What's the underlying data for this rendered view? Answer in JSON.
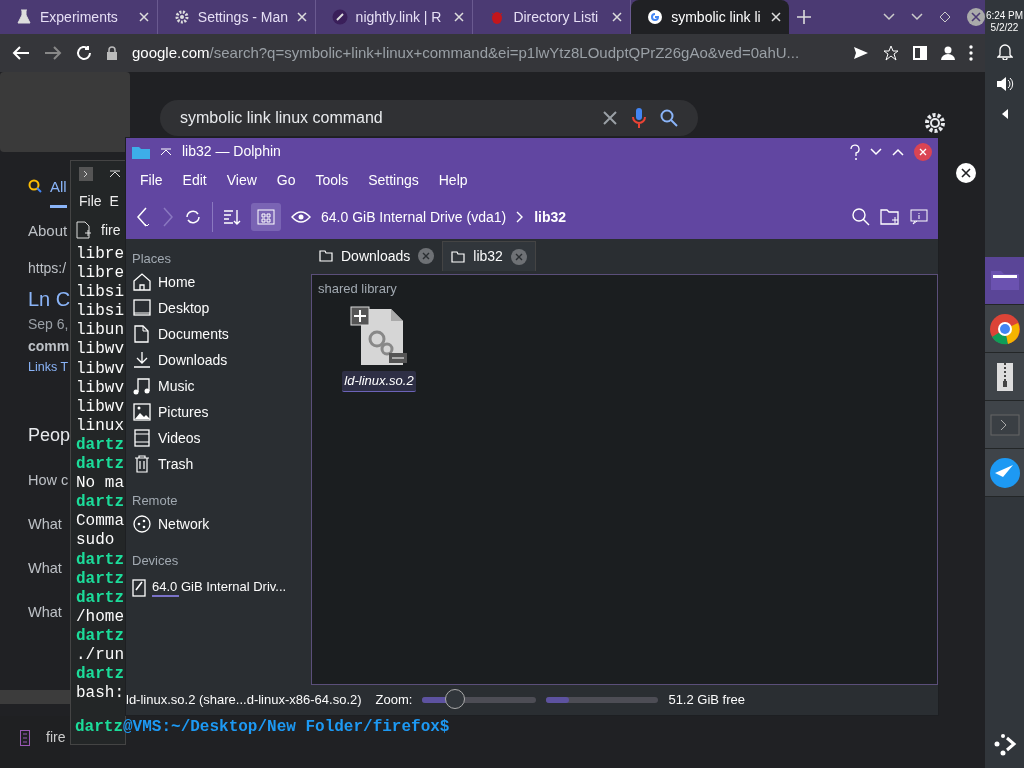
{
  "browser": {
    "tabs": [
      {
        "label": "Experiments",
        "selected": false
      },
      {
        "label": "Settings - Man",
        "selected": false
      },
      {
        "label": "nightly.link | R",
        "selected": false
      },
      {
        "label": "Directory Listi",
        "selected": false
      },
      {
        "label": "symbolic link li",
        "selected": true
      }
    ],
    "address": {
      "host": "google.com",
      "rest": "/search?q=symbolic+link+linux+command&ei=p1lwYtz8LOudptQPrZ26gAo&ved=0ahU..."
    }
  },
  "google": {
    "query": "symbolic link linux command",
    "items": [
      {
        "kind": "tab",
        "text": "All"
      },
      {
        "kind": "meta",
        "text": "About"
      },
      {
        "kind": "url",
        "text": "https:/"
      },
      {
        "kind": "title",
        "text": "Ln C"
      },
      {
        "kind": "date",
        "text": "Sep 6,"
      },
      {
        "kind": "bold",
        "text": "comm"
      },
      {
        "kind": "link",
        "text": "Links T"
      },
      {
        "kind": "heading",
        "text": "Peop"
      },
      {
        "kind": "question",
        "text": "How c"
      },
      {
        "kind": "question",
        "text": "What"
      },
      {
        "kind": "question",
        "text": "What"
      },
      {
        "kind": "question",
        "text": "What"
      }
    ]
  },
  "terminal": {
    "menu": [
      "File",
      "E"
    ],
    "tab": "fire",
    "lines": [
      {
        "kind": "output",
        "text": "libre"
      },
      {
        "kind": "output",
        "text": "libre"
      },
      {
        "kind": "output",
        "text": "libsi"
      },
      {
        "kind": "output",
        "text": "libsi"
      },
      {
        "kind": "output",
        "text": "libun"
      },
      {
        "kind": "output",
        "text": "libwv"
      },
      {
        "kind": "output",
        "text": "libwv"
      },
      {
        "kind": "output",
        "text": "libwv"
      },
      {
        "kind": "output",
        "text": "libwv"
      },
      {
        "kind": "output",
        "text": "linux"
      },
      {
        "kind": "prompt",
        "text": "dartz"
      },
      {
        "kind": "prompt",
        "text": "dartz"
      },
      {
        "kind": "output",
        "text": "No ma"
      },
      {
        "kind": "prompt",
        "text": "dartz"
      },
      {
        "kind": "output",
        "text": "Comma"
      },
      {
        "kind": "output",
        "text": "sudo"
      },
      {
        "kind": "prompt",
        "text": "dartz"
      },
      {
        "kind": "prompt",
        "text": "dartz"
      },
      {
        "kind": "prompt",
        "text": "dartz"
      },
      {
        "kind": "output",
        "text": "/home"
      },
      {
        "kind": "prompt",
        "text": "dartz"
      },
      {
        "kind": "output",
        "text": "./run"
      },
      {
        "kind": "prompt",
        "text": "dartz"
      },
      {
        "kind": "output",
        "text": "bash:"
      }
    ],
    "last_prompt": {
      "user": "dartz",
      "path": "@VMS:~/Desktop/New Folder/firefox$"
    }
  },
  "dolphin": {
    "title": "lib32 — Dolphin",
    "menu": [
      "File",
      "Edit",
      "View",
      "Go",
      "Tools",
      "Settings",
      "Help"
    ],
    "breadcrumb": [
      {
        "text": "64.0 GiB Internal Drive (vda1)",
        "selected": false
      },
      {
        "text": "lib32",
        "selected": true
      }
    ],
    "tabs": [
      {
        "label": "Downloads",
        "selected": false
      },
      {
        "label": "lib32",
        "selected": true
      }
    ],
    "places": [
      {
        "kind": "header",
        "text": "Places"
      },
      {
        "kind": "item",
        "text": "Home"
      },
      {
        "kind": "item",
        "text": "Desktop"
      },
      {
        "kind": "item",
        "text": "Documents"
      },
      {
        "kind": "item",
        "text": "Downloads"
      },
      {
        "kind": "item",
        "text": "Music"
      },
      {
        "kind": "item",
        "text": "Pictures"
      },
      {
        "kind": "item",
        "text": "Videos"
      },
      {
        "kind": "item",
        "text": "Trash"
      },
      {
        "kind": "header",
        "text": "Remote"
      },
      {
        "kind": "item",
        "text": "Network"
      },
      {
        "kind": "header",
        "text": "Devices"
      },
      {
        "kind": "device",
        "text": "64.0 GiB Internal Driv...",
        "level": 0.2
      }
    ],
    "group": "shared library",
    "files": [
      {
        "name": "ld-linux.so.2",
        "selected": true
      }
    ],
    "status": {
      "text": "ld-linux.so.2 (share...d-linux-x86-64.so.2)",
      "zoom_label": "Zoom:",
      "zoom": {
        "level": 0.29
      },
      "space": {
        "level": 0.2
      },
      "free": "51.2 GiB free"
    }
  },
  "panel": {
    "time": "6:24 PM",
    "date": "5/2/22",
    "tasks": [
      {
        "selected": true
      },
      {
        "selected": false
      },
      {
        "selected": false
      },
      {
        "selected": false
      },
      {
        "selected": false
      }
    ]
  },
  "taskbar": {
    "label": "fire"
  }
}
